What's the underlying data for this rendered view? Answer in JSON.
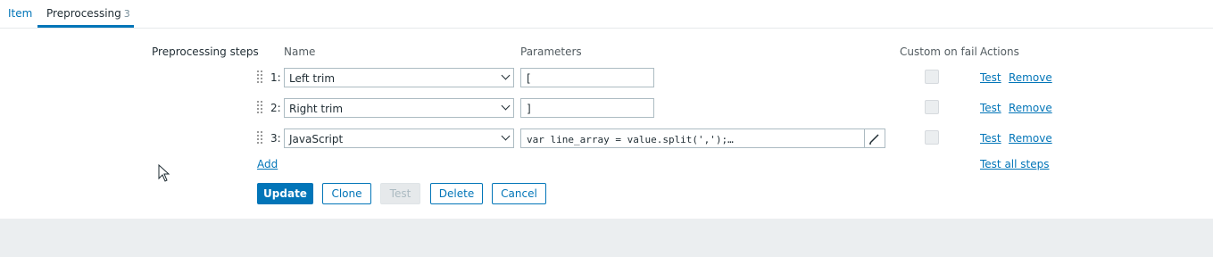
{
  "tabs": [
    {
      "label": "Item"
    },
    {
      "label": "Preprocessing",
      "count": "3"
    }
  ],
  "preprocessing": {
    "section_label": "Preprocessing steps",
    "columns": {
      "name": "Name",
      "parameters": "Parameters",
      "custom_on_fail": "Custom on fail",
      "actions": "Actions"
    },
    "steps": [
      {
        "num": "1:",
        "name": "Left trim",
        "param": "[",
        "test": "Test",
        "remove": "Remove"
      },
      {
        "num": "2:",
        "name": "Right trim",
        "param": "]",
        "test": "Test",
        "remove": "Remove"
      },
      {
        "num": "3:",
        "name": "JavaScript",
        "param": "var line_array = value.split(',');…",
        "test": "Test",
        "remove": "Remove"
      }
    ],
    "add_label": "Add",
    "test_all_label": "Test all steps"
  },
  "buttons": {
    "update": "Update",
    "clone": "Clone",
    "test": "Test",
    "delete": "Delete",
    "cancel": "Cancel"
  },
  "colors": {
    "accent": "#0275b8",
    "background": "#ebeef0"
  }
}
